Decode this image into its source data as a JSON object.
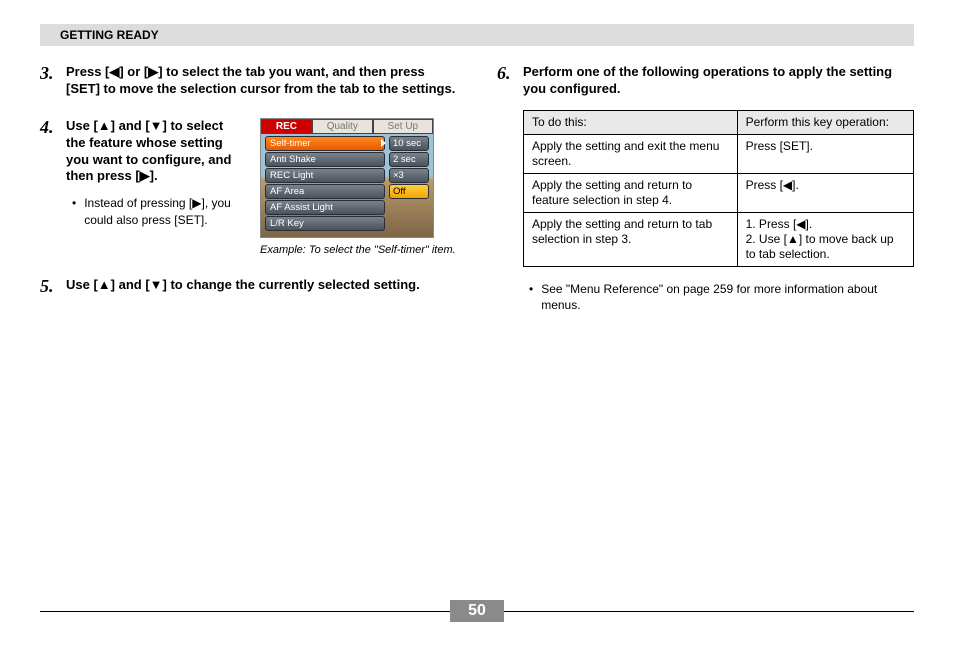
{
  "header": "GETTING READY",
  "page_number": "50",
  "left": {
    "step3": {
      "num": "3.",
      "text": "Press [◀] or [▶] to select the tab you want, and then press [SET] to move the selection cursor from the tab to the settings."
    },
    "step4": {
      "num": "4.",
      "text": "Use [▲] and [▼] to select the feature whose setting you want to configure, and then press [▶].",
      "note": "Instead of pressing [▶], you could also press [SET].",
      "caption": "Example: To select the \"Self-timer\" item."
    },
    "step5": {
      "num": "5.",
      "text": "Use [▲] and [▼] to change the currently selected setting."
    }
  },
  "camera_menu": {
    "tabs": [
      "REC",
      "Quality",
      "Set Up"
    ],
    "active_tab": 0,
    "items": [
      "Self-timer",
      "Anti Shake",
      "REC Light",
      "AF Area",
      "AF Assist Light",
      "L/R Key"
    ],
    "selected_item": 0,
    "options": [
      "10 sec",
      "2 sec",
      "×3",
      "Off"
    ],
    "selected_option": 3
  },
  "right": {
    "step6": {
      "num": "6.",
      "text": "Perform one of the following operations to apply the setting you configured."
    },
    "table": {
      "headers": [
        "To do this:",
        "Perform this key operation:"
      ],
      "rows": [
        [
          "Apply the setting and exit the menu screen.",
          "Press [SET]."
        ],
        [
          "Apply the setting and return to feature selection in step 4.",
          "Press [◀]."
        ],
        [
          "Apply the setting and return to tab selection in step 3.",
          "1. Press [◀].\n2. Use [▲] to move back up to tab selection."
        ]
      ]
    },
    "footnote": "See \"Menu Reference\" on page 259 for more information about menus."
  }
}
